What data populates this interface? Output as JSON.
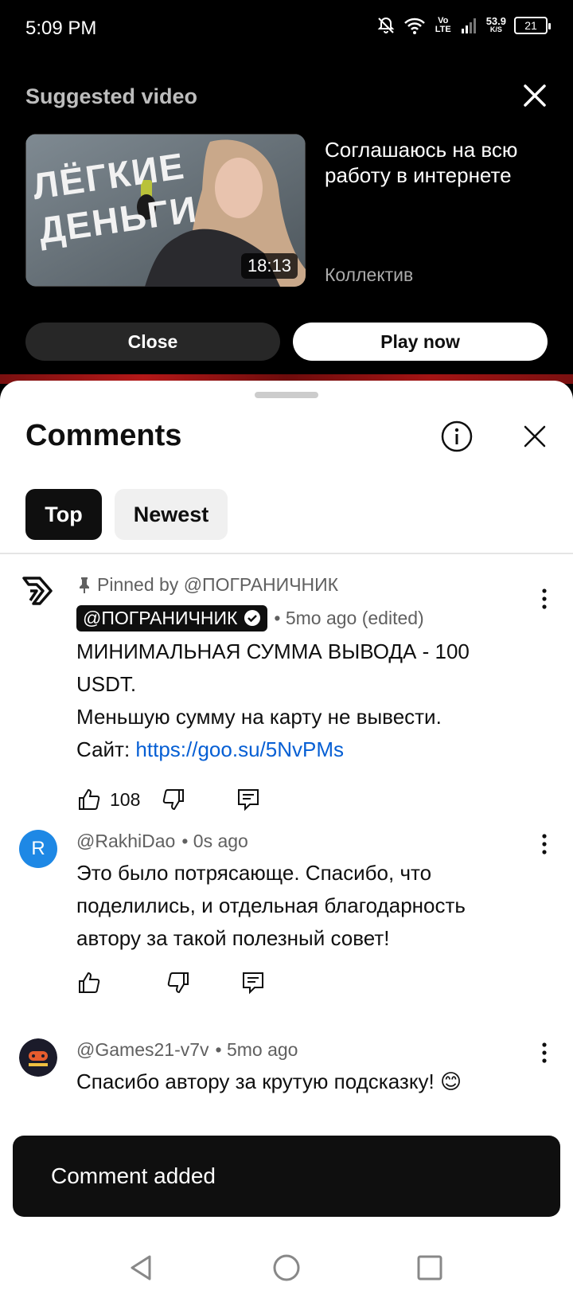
{
  "status_bar": {
    "time": "5:09 PM",
    "network_label": "Vo LTE",
    "speed_value": "53.9",
    "speed_unit": "K/S",
    "battery": "21"
  },
  "suggested_video": {
    "heading": "Suggested video",
    "thumbnail_text": "ЛЁГКИЕ ДЕНЬГИ",
    "duration": "18:13",
    "title": "Соглашаюсь на всю работу в интернете",
    "channel": "Коллектив",
    "close_label": "Close",
    "play_label": "Play now"
  },
  "comments_panel": {
    "title": "Comments",
    "chips": [
      {
        "label": "Top",
        "selected": true
      },
      {
        "label": "Newest",
        "selected": false
      }
    ]
  },
  "comments": [
    {
      "pinned_text": "Pinned by @ПОГРАНИЧНИК",
      "author": "@ПОГРАНИЧНИК",
      "meta": "• 5mo ago (edited)",
      "line1": "МИНИМАЛЬНАЯ СУММА ВЫВОДА - 100 USDT.",
      "line2": "Меньшую сумму на карту не вывести.",
      "site_label": "Сайт: ",
      "link": "https://goo.su/5NvPMs",
      "likes": "108"
    },
    {
      "avatar_letter": "R",
      "author": "@RakhiDao",
      "meta": "• 0s ago",
      "text": "Это было потрясающе. Спасибо, что поделились, и отдельная благодарность автору за такой полезный совет!"
    },
    {
      "author": "@Games21-v7v",
      "meta": "• 5mo ago",
      "text": "Спасибо автору за крутую подсказку! 😊"
    }
  ],
  "snackbar": {
    "text": "Comment added"
  },
  "colors": {
    "link": "#065fd4",
    "avatar_r": "#1e88e5",
    "chip_selected": "#0f0f0f",
    "chip_unselected": "#f0f0f0"
  }
}
